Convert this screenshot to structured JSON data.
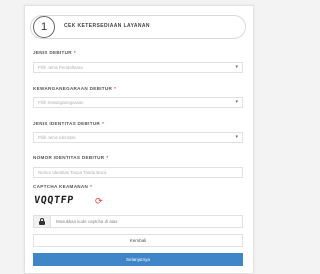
{
  "header": {
    "step_number": "1",
    "title": "CEK KETERSEDIAAN LAYANAN"
  },
  "form": {
    "jenis_debitur": {
      "label": "JENIS DEBITUR",
      "required_mark": "*",
      "placeholder": "Pilih Jenis Pendaftaran"
    },
    "kewarganegaraan": {
      "label": "KEWARGANEGARAAN DEBITUR",
      "required_mark": "*",
      "placeholder": "Pilih Kewarganegaraan"
    },
    "jenis_identitas": {
      "label": "JENIS IDENTITAS DEBITUR",
      "required_mark": "*",
      "placeholder": "Pilih Jenis Identitas"
    },
    "nomor_identitas": {
      "label": "NOMOR IDENTITAS DEBITUR",
      "required_mark": "*",
      "placeholder": "Nomor Identitas Tanpa Tanda Baca"
    },
    "captcha": {
      "label": "CAPTCHA KEAMANAN",
      "required_mark": "*",
      "code": "VQQTFP",
      "input_placeholder": "Masukkan kode captcha di atas"
    }
  },
  "buttons": {
    "back": "Kembali",
    "next": "Selanjutnya"
  },
  "colors": {
    "primary": "#3f86c9",
    "required": "#e53935"
  }
}
